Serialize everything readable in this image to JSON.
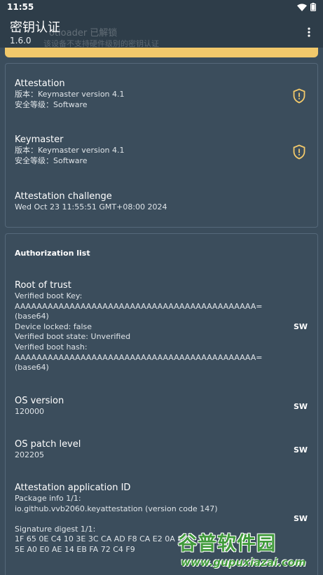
{
  "status_bar": {
    "time": "11:55"
  },
  "app_bar": {
    "title": "密钥认证",
    "version": "1.6.0",
    "ghost_text": "otloader 已解锁",
    "ghost_subtext": "该设备不支持硬件级别的密钥认证"
  },
  "colors": {
    "warning": "#f2c96b",
    "background": "#3b4d5c",
    "appbar": "#2e3d49",
    "watermark": "#3f9a3a"
  },
  "attestation": {
    "title": "Attestation",
    "version_line": "版本：Keymaster version 4.1",
    "security_line": "安全等级：Software",
    "icon": "shield-warning-icon"
  },
  "keymaster": {
    "title": "Keymaster",
    "version_line": "版本：Keymaster version 4.1",
    "security_line": "安全等级：Software",
    "icon": "shield-warning-icon"
  },
  "challenge": {
    "title": "Attestation challenge",
    "value": "Wed Oct 23 11:55:51 GMT+08:00 2024"
  },
  "authorization": {
    "heading": "Authorization list",
    "root_of_trust": {
      "title": "Root of trust",
      "lines": [
        "Verified boot Key:",
        "AAAAAAAAAAAAAAAAAAAAAAAAAAAAAAAAAAAAAAAAAAAA=",
        "(base64)",
        "Device locked: false",
        "Verified boot state: Unverified",
        "Verified boot hash:",
        "AAAAAAAAAAAAAAAAAAAAAAAAAAAAAAAAAAAAAAAAAAAA=",
        "(base64)"
      ],
      "badge": "SW"
    },
    "os_version": {
      "title": "OS version",
      "value": "120000",
      "badge": "SW"
    },
    "os_patch": {
      "title": "OS patch level",
      "value": "202205",
      "badge": "SW"
    },
    "app_id": {
      "title": "Attestation application ID",
      "lines": [
        "Package info 1/1:",
        "io.github.vvb2060.keyattestation (version code 147)",
        "",
        "Signature digest 1/1:",
        "1F 65 0E C4 10 3E 3C CA AD F8 CA E2 0A 8",
        "5E A0 E0 AE 14 EB FA 72 C4 F9"
      ],
      "badge": "SW"
    }
  },
  "watermark": {
    "brand": "谷普软件园",
    "url": "www.gupuxiazai.com"
  }
}
